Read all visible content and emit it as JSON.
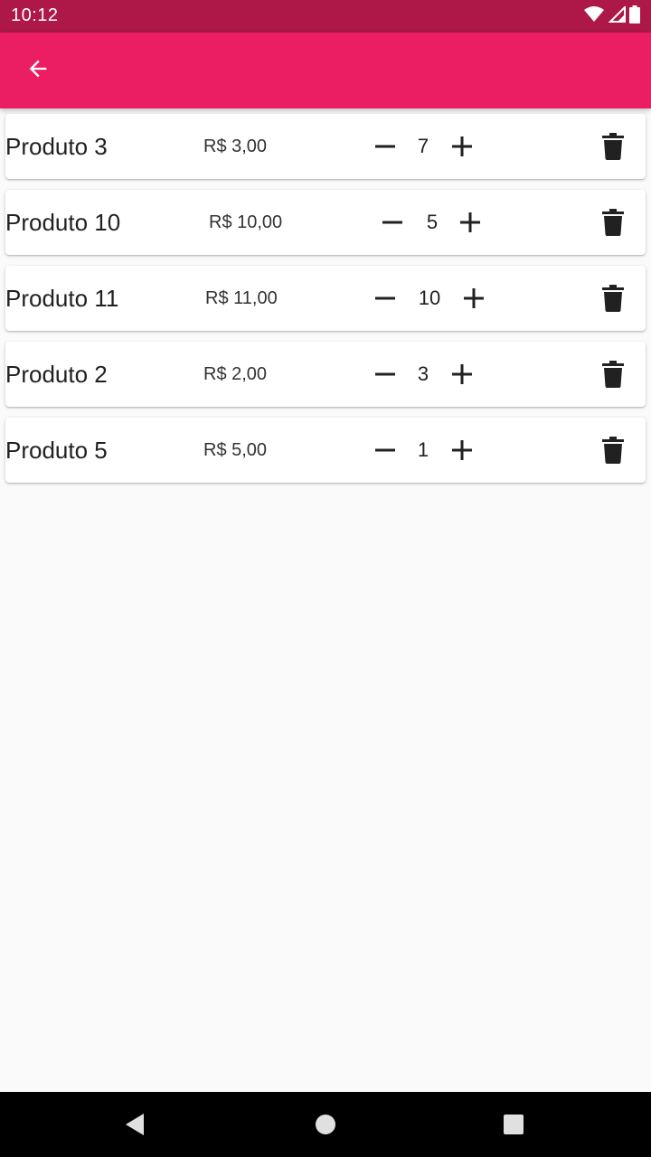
{
  "status_bar": {
    "time": "10:12",
    "icons": [
      "wifi-icon",
      "signal-icon",
      "battery-icon"
    ],
    "color": "#AD1849"
  },
  "app_bar": {
    "color": "#EC1E63",
    "back_icon": "arrow-left-icon"
  },
  "cart": {
    "items": [
      {
        "name": "Produto 3",
        "price": "R$ 3,00",
        "quantity": "7"
      },
      {
        "name": "Produto 10",
        "price": "R$ 10,00",
        "quantity": "5"
      },
      {
        "name": "Produto 11",
        "price": "R$ 11,00",
        "quantity": "10"
      },
      {
        "name": "Produto 2",
        "price": "R$ 2,00",
        "quantity": "3"
      },
      {
        "name": "Produto 5",
        "price": "R$ 5,00",
        "quantity": "1"
      }
    ],
    "icons": {
      "decrease": "minus-icon",
      "increase": "plus-icon",
      "delete": "trash-icon"
    }
  },
  "nav_bar": {
    "icons": [
      "back-triangle-icon",
      "home-circle-icon",
      "recents-square-icon"
    ]
  }
}
